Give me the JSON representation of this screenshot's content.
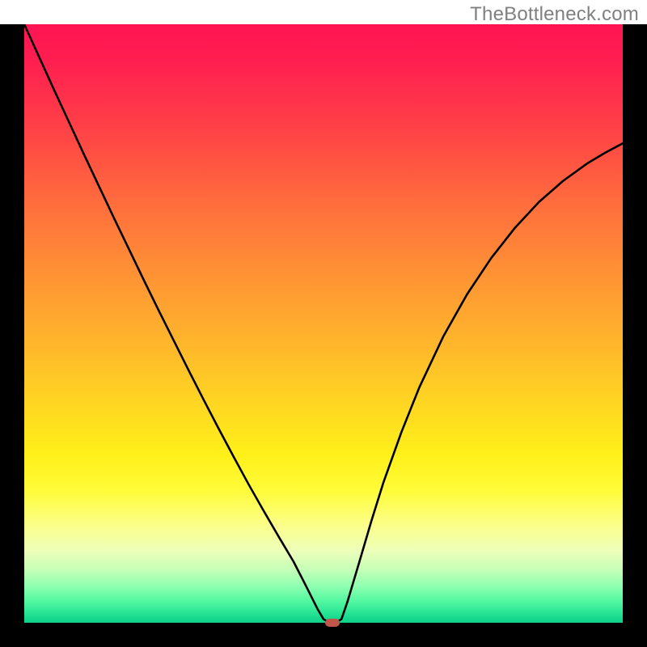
{
  "watermark": "TheBottleneck.com",
  "colors": {
    "frame_bg": "#000000",
    "marker": "#c0554a",
    "curve": "#000000"
  },
  "chart_data": {
    "type": "line",
    "title": "",
    "xlabel": "",
    "ylabel": "",
    "xlim": [
      0,
      1
    ],
    "ylim": [
      0,
      1
    ],
    "series": [
      {
        "name": "bottleneck-curve",
        "x": [
          0.0,
          0.025,
          0.05,
          0.075,
          0.1,
          0.125,
          0.15,
          0.175,
          0.2,
          0.225,
          0.25,
          0.275,
          0.3,
          0.325,
          0.35,
          0.375,
          0.4,
          0.425,
          0.45,
          0.47,
          0.48,
          0.49,
          0.5,
          0.51,
          0.52,
          0.53,
          0.54,
          0.56,
          0.58,
          0.6,
          0.63,
          0.66,
          0.7,
          0.74,
          0.78,
          0.82,
          0.86,
          0.9,
          0.94,
          0.97,
          1.0
        ],
        "y": [
          1.0,
          0.945,
          0.89,
          0.836,
          0.782,
          0.729,
          0.676,
          0.624,
          0.572,
          0.521,
          0.471,
          0.421,
          0.372,
          0.324,
          0.277,
          0.231,
          0.187,
          0.144,
          0.102,
          0.063,
          0.043,
          0.023,
          0.006,
          0.0,
          0.0,
          0.006,
          0.035,
          0.102,
          0.17,
          0.234,
          0.318,
          0.393,
          0.478,
          0.549,
          0.609,
          0.66,
          0.703,
          0.738,
          0.767,
          0.785,
          0.801
        ]
      }
    ],
    "marker": {
      "x": 0.515,
      "y": 0.0
    },
    "gradient_stops": [
      {
        "pos": 0.0,
        "color": "#ff1452"
      },
      {
        "pos": 0.5,
        "color": "#ffb82b"
      },
      {
        "pos": 0.78,
        "color": "#fffc3a"
      },
      {
        "pos": 1.0,
        "color": "#10d28a"
      }
    ]
  }
}
